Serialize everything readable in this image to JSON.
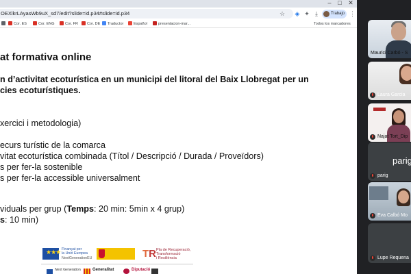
{
  "browser": {
    "url": "OEXlkrLAyasWb9uX_sd7/edit?slide=id.p34#slide=id.p34",
    "profile_label": "Trabajo",
    "bookmarks": [
      {
        "label": "Cor. ES",
        "color": "#d93025"
      },
      {
        "label": "Cor. ENG",
        "color": "#d93025"
      },
      {
        "label": "Cor. FR",
        "color": "#d93025"
      },
      {
        "label": "Cor. DE",
        "color": "#d93025"
      },
      {
        "label": "Traductor",
        "color": "#4285f4"
      },
      {
        "label": "Español",
        "color": "#ea4335"
      },
      {
        "label": "presentacion-mar...",
        "color": "#c5221f"
      }
    ],
    "all_bookmarks": "Todos los marcadores"
  },
  "slide": {
    "title": "at formativa online",
    "line1": "n d’activitat ecoturística en un municipi del litoral del Baix Llobregat per un",
    "line2": "cies ecoturístiques.",
    "line3": "xercici i metodologia)",
    "line4": "ecurs turístic de la comarca",
    "line5": "vitat ecoturística combinada (Títol / Descripció / Durada / Proveïdors)",
    "line6": "s per fer-la sostenible",
    "line7": "s per fer-la accessible universalment",
    "line8_pre": "viduals per grup (",
    "line8_bold": "Temps",
    "line8_post": ": 20 min: 5min x 4 grup)",
    "line9_bold": "s",
    "line9_post": ": 10 min)"
  },
  "logos": {
    "eu_line1": "Finançat per",
    "eu_line2": "la Unió Europea",
    "eu_line3": "NextGenerationEU",
    "tr_line1": "Pla de Recuperació,",
    "tr_line2": "Transformació",
    "tr_line3": "i Resiliència",
    "ng_text": "Next Generation",
    "gen_text": "Generalitat",
    "dip_text": "Diputació"
  },
  "participants": [
    {
      "name": "Maurici Carbó - S"
    },
    {
      "name": "Laura Garcia"
    },
    {
      "name": "Najat Tort_Dip"
    },
    {
      "name": "parig",
      "big": "parig"
    },
    {
      "name": "Eva Calbó Mo"
    },
    {
      "name": "Lupe Requena"
    }
  ]
}
